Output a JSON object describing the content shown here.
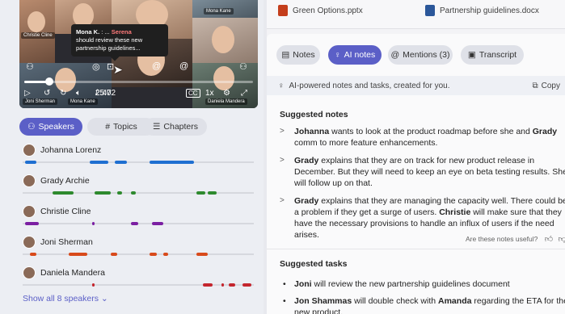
{
  "video": {
    "tiles": [
      {
        "name": "Christie Cline"
      },
      {
        "name": "Mona Kane"
      },
      {
        "name": "Joni Sherman"
      },
      {
        "name": "Mona Kane"
      },
      {
        "name": ""
      },
      {
        "name": "Daniela Mandera"
      }
    ],
    "tooltip": {
      "author": "Mona K.",
      "sep": " : ... ",
      "mention": "Serena",
      "text": "should review these new partnership guidelines..."
    },
    "time_current": "2:47",
    "time_total": "25:02",
    "time_sep": " / ",
    "speed": "1x",
    "progress_fraction": 0.111
  },
  "left_tabs": [
    {
      "label": "Speakers",
      "icon": "speakers-icon",
      "active": true
    },
    {
      "label": "Topics",
      "icon": "hash-icon",
      "active": false
    },
    {
      "label": "Chapters",
      "icon": "chapters-icon",
      "active": false
    }
  ],
  "speakers": [
    {
      "name": "Johanna Lorenz",
      "color": "#1f6fd1",
      "segments": [
        [
          0.01,
          0.06
        ],
        [
          0.29,
          0.37
        ],
        [
          0.4,
          0.45
        ],
        [
          0.55,
          0.74
        ]
      ]
    },
    {
      "name": "Grady Archie",
      "color": "#2e8a2e",
      "segments": [
        [
          0.13,
          0.22
        ],
        [
          0.31,
          0.38
        ],
        [
          0.41,
          0.43
        ],
        [
          0.47,
          0.49
        ],
        [
          0.75,
          0.79
        ],
        [
          0.8,
          0.84
        ]
      ]
    },
    {
      "name": "Christie Cline",
      "color": "#7b1fa2",
      "segments": [
        [
          0.01,
          0.07
        ],
        [
          0.3,
          0.31
        ],
        [
          0.47,
          0.5
        ],
        [
          0.56,
          0.61
        ]
      ]
    },
    {
      "name": "Joni Sherman",
      "color": "#d84a1b",
      "segments": [
        [
          0.03,
          0.06
        ],
        [
          0.2,
          0.28
        ],
        [
          0.38,
          0.41
        ],
        [
          0.55,
          0.58
        ],
        [
          0.61,
          0.63
        ],
        [
          0.75,
          0.8
        ]
      ]
    },
    {
      "name": "Daniela Mandera",
      "color": "#c4262e",
      "segments": [
        [
          0.3,
          0.31
        ],
        [
          0.78,
          0.82
        ],
        [
          0.86,
          0.87
        ],
        [
          0.89,
          0.92
        ],
        [
          0.95,
          0.99
        ]
      ]
    }
  ],
  "show_all": "Show all 8 speakers",
  "files": [
    {
      "name": "Green Options.pptx",
      "color": "#c43e1c"
    },
    {
      "name": "Partnership guidelines.docx",
      "color": "#2b579a"
    }
  ],
  "ai_tabs": [
    {
      "label": "Notes",
      "icon": "notes-icon",
      "active": false
    },
    {
      "label": "AI notes",
      "icon": "lightbulb-icon",
      "active": true
    },
    {
      "label": "Mentions (3)",
      "icon": "at-icon",
      "active": false
    },
    {
      "label": "Transcript",
      "icon": "transcript-icon",
      "active": false
    }
  ],
  "ai_banner": "AI-powered notes and tasks, created for you.",
  "copy_label": "Copy",
  "suggested_notes_title": "Suggested notes",
  "notes": [
    {
      "parts": [
        [
          "b",
          "Johanna"
        ],
        [
          "t",
          " wants to look at the product roadmap before she and "
        ],
        [
          "b",
          "Grady"
        ],
        [
          "t",
          " comm to more feature enhancements."
        ]
      ]
    },
    {
      "parts": [
        [
          "b",
          "Grady"
        ],
        [
          "t",
          " explains that they are on track for new product release in December. But they will need to keep an eye on beta testing results. She will follow up on that."
        ]
      ]
    },
    {
      "parts": [
        [
          "b",
          "Grady"
        ],
        [
          "t",
          " explains that they are managing the capacity well. There could be a problem if they get a surge of users. "
        ],
        [
          "b",
          "Christie"
        ],
        [
          "t",
          " will make sure that they have the necessary provisions to handle an influx of users if the need arises."
        ]
      ]
    }
  ],
  "feedback_question": "Are these notes useful?",
  "suggested_tasks_title": "Suggested tasks",
  "tasks": [
    {
      "parts": [
        [
          "b",
          "Joni"
        ],
        [
          "t",
          " will review the new partnership guidelines document"
        ]
      ]
    },
    {
      "parts": [
        [
          "b",
          "Jon Shammas"
        ],
        [
          "t",
          " will double check with "
        ],
        [
          "b",
          "Amanda"
        ],
        [
          "t",
          " regarding the ETA for the new product."
        ]
      ]
    }
  ]
}
